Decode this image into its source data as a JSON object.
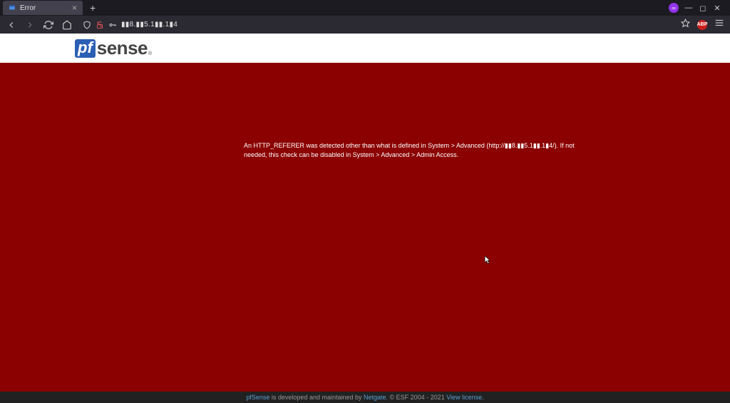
{
  "browser": {
    "tab": {
      "title": "Error"
    },
    "address": "▮▮8.▮▮5.1▮▮.1▮4"
  },
  "page": {
    "logo": {
      "pf": "pf",
      "sense": "sense",
      "reg": "®"
    },
    "error_message": "An HTTP_REFERER was detected other than what is defined in System > Advanced (http://▮▮8.▮▮5.1▮▮.1▮4/). If not needed, this check can be disabled in System > Advanced > Admin Access."
  },
  "footer": {
    "prefix": "pfSense",
    "mid": " is developed and maintained by ",
    "netgate": "Netgate",
    "copyright": ". © ESF 2004 - 2021 ",
    "license": "View license",
    "dot": "."
  }
}
